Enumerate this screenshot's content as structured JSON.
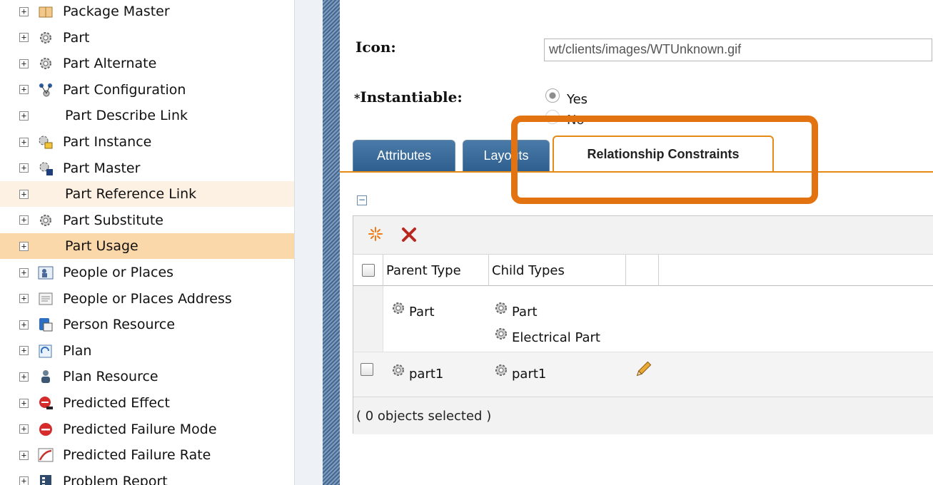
{
  "tree": {
    "items": [
      {
        "label": "Package Master",
        "icon": "package-icon"
      },
      {
        "label": "Part",
        "icon": "gear-icon"
      },
      {
        "label": "Part Alternate",
        "icon": "gear-icon"
      },
      {
        "label": "Part Configuration",
        "icon": "configuration-icon"
      },
      {
        "label": "Part Describe Link",
        "icon": ""
      },
      {
        "label": "Part Instance",
        "icon": "instance-icon"
      },
      {
        "label": "Part Master",
        "icon": "master-icon"
      },
      {
        "label": "Part Reference Link",
        "icon": ""
      },
      {
        "label": "Part Substitute",
        "icon": "gear-icon"
      },
      {
        "label": "Part Usage",
        "icon": ""
      },
      {
        "label": "People or Places",
        "icon": "people-icon"
      },
      {
        "label": "People or Places Address",
        "icon": "address-icon"
      },
      {
        "label": "Person Resource",
        "icon": "person-resource-icon"
      },
      {
        "label": "Plan",
        "icon": "plan-icon"
      },
      {
        "label": "Plan Resource",
        "icon": "user-icon"
      },
      {
        "label": "Predicted Effect",
        "icon": "effect-icon"
      },
      {
        "label": "Predicted Failure Mode",
        "icon": "stop-icon"
      },
      {
        "label": "Predicted Failure Rate",
        "icon": "rate-chart-icon"
      },
      {
        "label": "Problem Report",
        "icon": "report-icon"
      }
    ],
    "highlight_colors": {
      "hover": "#fdf1e3",
      "selected": "#fbd8a9"
    }
  },
  "form": {
    "icon_label": "Icon:",
    "icon_value": "wt/clients/images/WTUnknown.gif",
    "instantiable_label": "Instantiable:",
    "required_mark": "*",
    "yes_label": "Yes",
    "no_label": "No"
  },
  "tabs": [
    {
      "label": "Attributes"
    },
    {
      "label": "Layouts"
    },
    {
      "label": "Relationship Constraints",
      "active": true
    }
  ],
  "accent_color": "#e37311",
  "grid": {
    "columns": [
      "Parent Type",
      "Child Types"
    ],
    "rows": [
      {
        "parent": "Part",
        "children": [
          "Part",
          "Electrical Part"
        ]
      },
      {
        "parent": "part1",
        "children": [
          "part1"
        ]
      }
    ],
    "footer": "( 0 objects selected )"
  }
}
